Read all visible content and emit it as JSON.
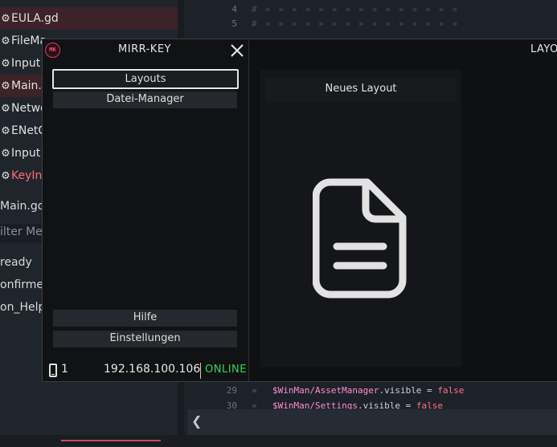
{
  "background": {
    "files": [
      {
        "name": "EULA.gd",
        "highlight": true,
        "red": false
      },
      {
        "name": "FileMa",
        "highlight": false,
        "red": false
      },
      {
        "name": "Input",
        "highlight": false,
        "red": false
      },
      {
        "name": "Main.",
        "highlight": true,
        "red": false
      },
      {
        "name": "Netwo",
        "highlight": false,
        "red": false
      },
      {
        "name": "ENetC",
        "highlight": false,
        "red": false
      },
      {
        "name": "Input",
        "highlight": false,
        "red": false
      },
      {
        "name": "KeyIn",
        "highlight": false,
        "red": true
      }
    ],
    "current_script": "Main.gd",
    "filter_placeholder": "ilter Met",
    "methods": [
      "ready",
      "onfirme",
      "on_Help"
    ],
    "code_lines": [
      {
        "num": "4",
        "code": ""
      },
      {
        "num": "5",
        "code": ""
      },
      {
        "num": "29",
        "var": "$WinMan/AssetManager",
        "prop": ".visible",
        "op": " = ",
        "val": "false"
      },
      {
        "num": "30",
        "var": "$WinMan/Settings",
        "prop": ".visible",
        "op": " = ",
        "val": "false"
      }
    ],
    "collapse_glyph": "❮"
  },
  "mirrkey": {
    "logo_text": "MK",
    "title": "MIRR-KEY",
    "right_title": "LAYO",
    "nav": {
      "layouts": "Layouts",
      "file_manager": "Datei-Manager",
      "help": "Hilfe",
      "settings": "Einstellungen"
    },
    "status": {
      "devices": "1",
      "ip": "192.168.100.106",
      "state": "ONLINE",
      "state_color": "#39d353"
    },
    "new_layout": "Neues Layout",
    "icons": {
      "close": "close-icon",
      "phone": "phone-icon",
      "document": "document-icon"
    }
  }
}
